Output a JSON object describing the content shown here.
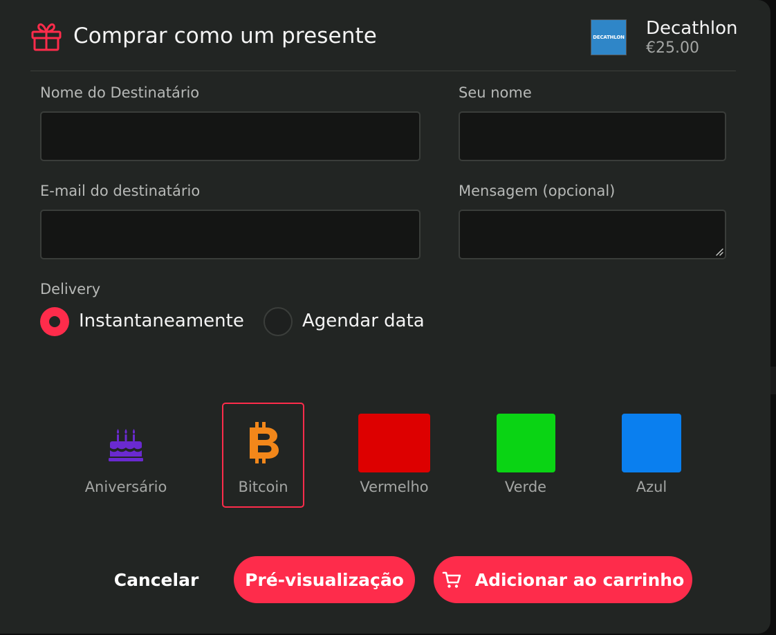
{
  "header": {
    "title": "Comprar como um presente",
    "gift_icon": "gift-icon",
    "brand": {
      "logo_text": "DECATHLON",
      "name": "Decathlon",
      "price": "€25.00",
      "logo_color": "#2f86c8"
    }
  },
  "form": {
    "recipient_name": {
      "label": "Nome do Destinatário",
      "value": ""
    },
    "your_name": {
      "label": "Seu nome",
      "value": ""
    },
    "recipient_email": {
      "label": "E-mail do destinatário",
      "value": ""
    },
    "message": {
      "label": "Mensagem (opcional)",
      "value": ""
    }
  },
  "delivery": {
    "label": "Delivery",
    "options": [
      {
        "label": "Instantaneamente",
        "selected": true
      },
      {
        "label": "Agendar data",
        "selected": false
      }
    ]
  },
  "themes": [
    {
      "label": "Aniversário",
      "icon": "birthday-cake-icon",
      "color": "#6a2ad0",
      "selected": false
    },
    {
      "label": "Bitcoin",
      "icon": "bitcoin-icon",
      "color": "#f2871a",
      "selected": true
    },
    {
      "label": "Vermelho",
      "color": "#dd0000",
      "selected": false
    },
    {
      "label": "Verde",
      "color": "#0ad414",
      "selected": false
    },
    {
      "label": "Azul",
      "color": "#0a7fef",
      "selected": false
    }
  ],
  "actions": {
    "cancel": "Cancelar",
    "preview": "Pré-visualização",
    "add_to_cart": "Adicionar ao carrinho",
    "cart_icon": "cart-icon"
  },
  "colors": {
    "accent": "#fe2c4b",
    "background": "#222523",
    "input_bg": "#141514"
  }
}
